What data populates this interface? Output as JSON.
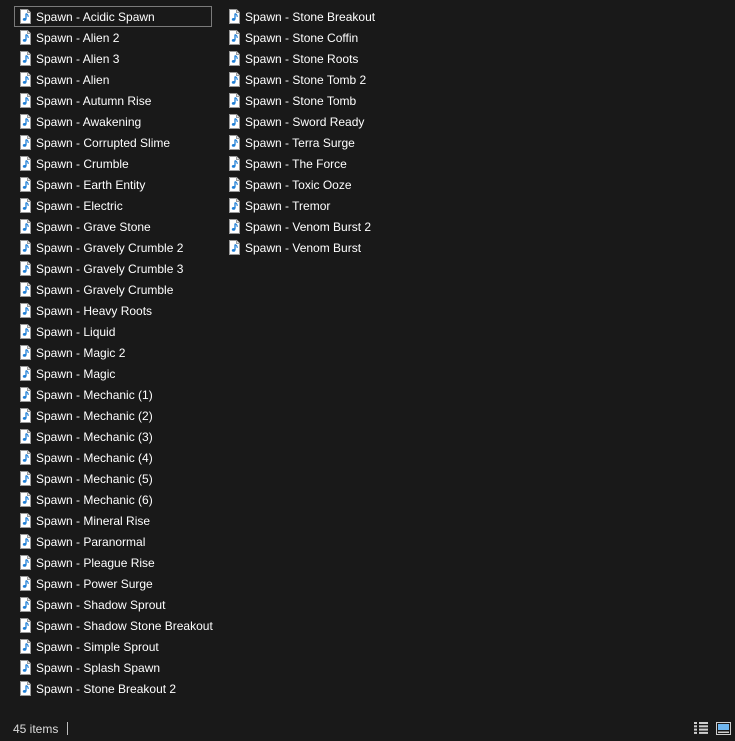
{
  "files": {
    "column_1": [
      "Spawn - Acidic Spawn",
      "Spawn - Alien 2",
      "Spawn - Alien 3",
      "Spawn - Alien",
      "Spawn - Autumn Rise",
      "Spawn - Awakening",
      "Spawn - Corrupted Slime",
      "Spawn - Crumble",
      "Spawn - Earth Entity",
      "Spawn - Electric",
      "Spawn - Grave Stone",
      "Spawn - Gravely Crumble 2",
      "Spawn - Gravely Crumble 3",
      "Spawn - Gravely Crumble",
      "Spawn - Heavy Roots",
      "Spawn - Liquid",
      "Spawn - Magic 2",
      "Spawn - Magic",
      "Spawn - Mechanic (1)",
      "Spawn - Mechanic (2)",
      "Spawn - Mechanic (3)",
      "Spawn - Mechanic (4)",
      "Spawn - Mechanic (5)",
      "Spawn - Mechanic (6)",
      "Spawn - Mineral Rise",
      "Spawn - Paranormal",
      "Spawn - Pleague Rise",
      "Spawn - Power Surge",
      "Spawn - Shadow Sprout",
      "Spawn - Shadow Stone Breakout",
      "Spawn - Simple Sprout",
      "Spawn - Splash Spawn",
      "Spawn - Stone Breakout 2"
    ],
    "column_2": [
      "Spawn - Stone Breakout",
      "Spawn - Stone Coffin",
      "Spawn - Stone Roots",
      "Spawn - Stone Tomb 2",
      "Spawn - Stone Tomb",
      "Spawn - Sword Ready",
      "Spawn - Terra Surge",
      "Spawn - The Force",
      "Spawn - Toxic Ooze",
      "Spawn - Tremor",
      "Spawn - Venom Burst 2",
      "Spawn - Venom Burst"
    ],
    "icon": "audio-file-icon",
    "selected_item": "Spawn - Acidic Spawn"
  },
  "status_bar": {
    "item_count": "45 items",
    "view_buttons": [
      "details-view-icon",
      "large-icons-view-icon"
    ]
  },
  "colors": {
    "background": "#191919",
    "text": "#ffffff",
    "selection_border": "#7a7a7a",
    "icon_accent": "#1f7fd6"
  }
}
